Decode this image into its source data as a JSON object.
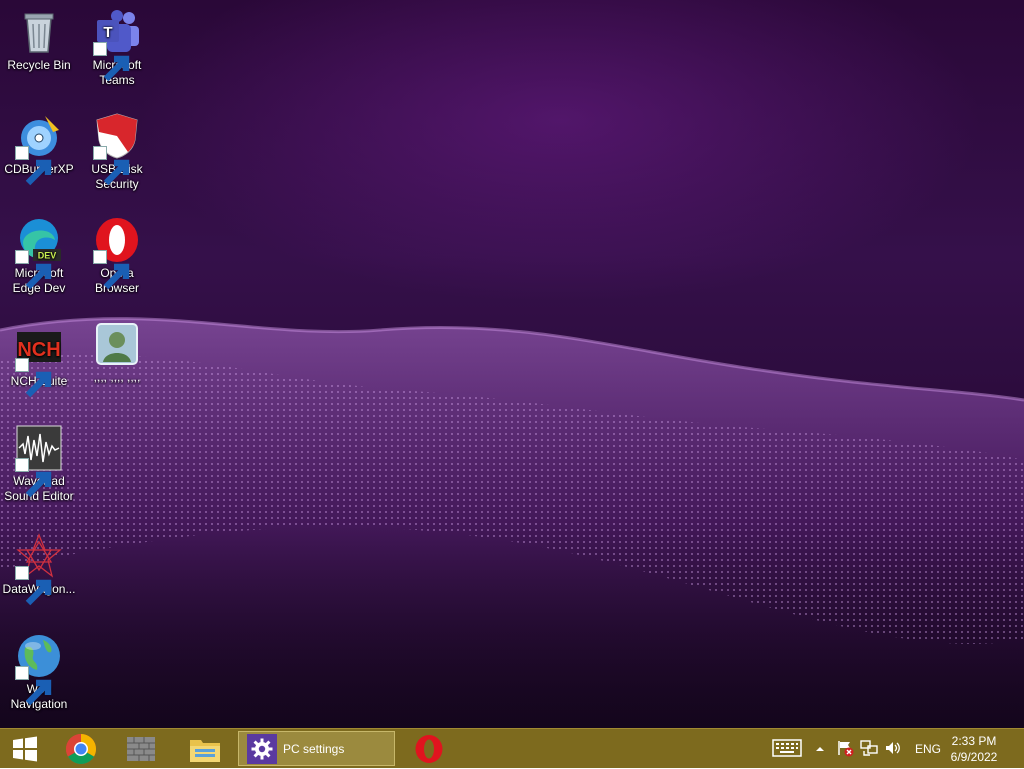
{
  "desktop": {
    "icons": [
      {
        "label": "Recycle Bin",
        "icon": "recycle-bin-icon"
      },
      {
        "label": "Microsoft Teams",
        "icon": "teams-icon"
      },
      {
        "label": "CDBurnerXP",
        "icon": "cdburnerxp-icon"
      },
      {
        "label": "USB Disk Security",
        "icon": "usb-disk-security-icon"
      },
      {
        "label": "Microsoft Edge Dev",
        "icon": "edge-dev-icon",
        "badge": "DEV"
      },
      {
        "label": "Opera Browser",
        "icon": "opera-icon"
      },
      {
        "label": "NCH Suite",
        "icon": "nch-icon",
        "badge": "NCH"
      },
      {
        "label": ",,,, ,,,, ,,,,",
        "icon": "user-contact-icon"
      },
      {
        "label": "WavePad Sound Editor",
        "icon": "wavepad-icon"
      },
      {
        "label": "DataWagon...",
        "icon": "datawagon-icon"
      },
      {
        "label": "Web Navigation",
        "icon": "globe-icon"
      }
    ]
  },
  "taskbar": {
    "start_icon": "windows-start-icon",
    "pinned": [
      {
        "name": "chrome",
        "icon": "chrome-icon"
      },
      {
        "name": "firewall",
        "icon": "firewall-wall-icon"
      },
      {
        "name": "file-explorer",
        "icon": "folder-icon"
      }
    ],
    "active_window": {
      "label": "PC settings",
      "icon": "gear-icon"
    },
    "opera": {
      "icon": "opera-icon"
    },
    "tray": {
      "keyboard_icon": "keyboard-icon",
      "chevron_icon": "chevron-up-icon",
      "flag_icon": "action-center-flag-icon",
      "network_icon": "network-icon",
      "volume_icon": "volume-icon",
      "language": "ENG"
    },
    "clock": {
      "time": "2:33 PM",
      "date": "6/9/2022"
    }
  },
  "colors": {
    "taskbar": "#7d6a1e",
    "desktop": "#35104a",
    "active_window_bg": "#9b8a3e"
  }
}
